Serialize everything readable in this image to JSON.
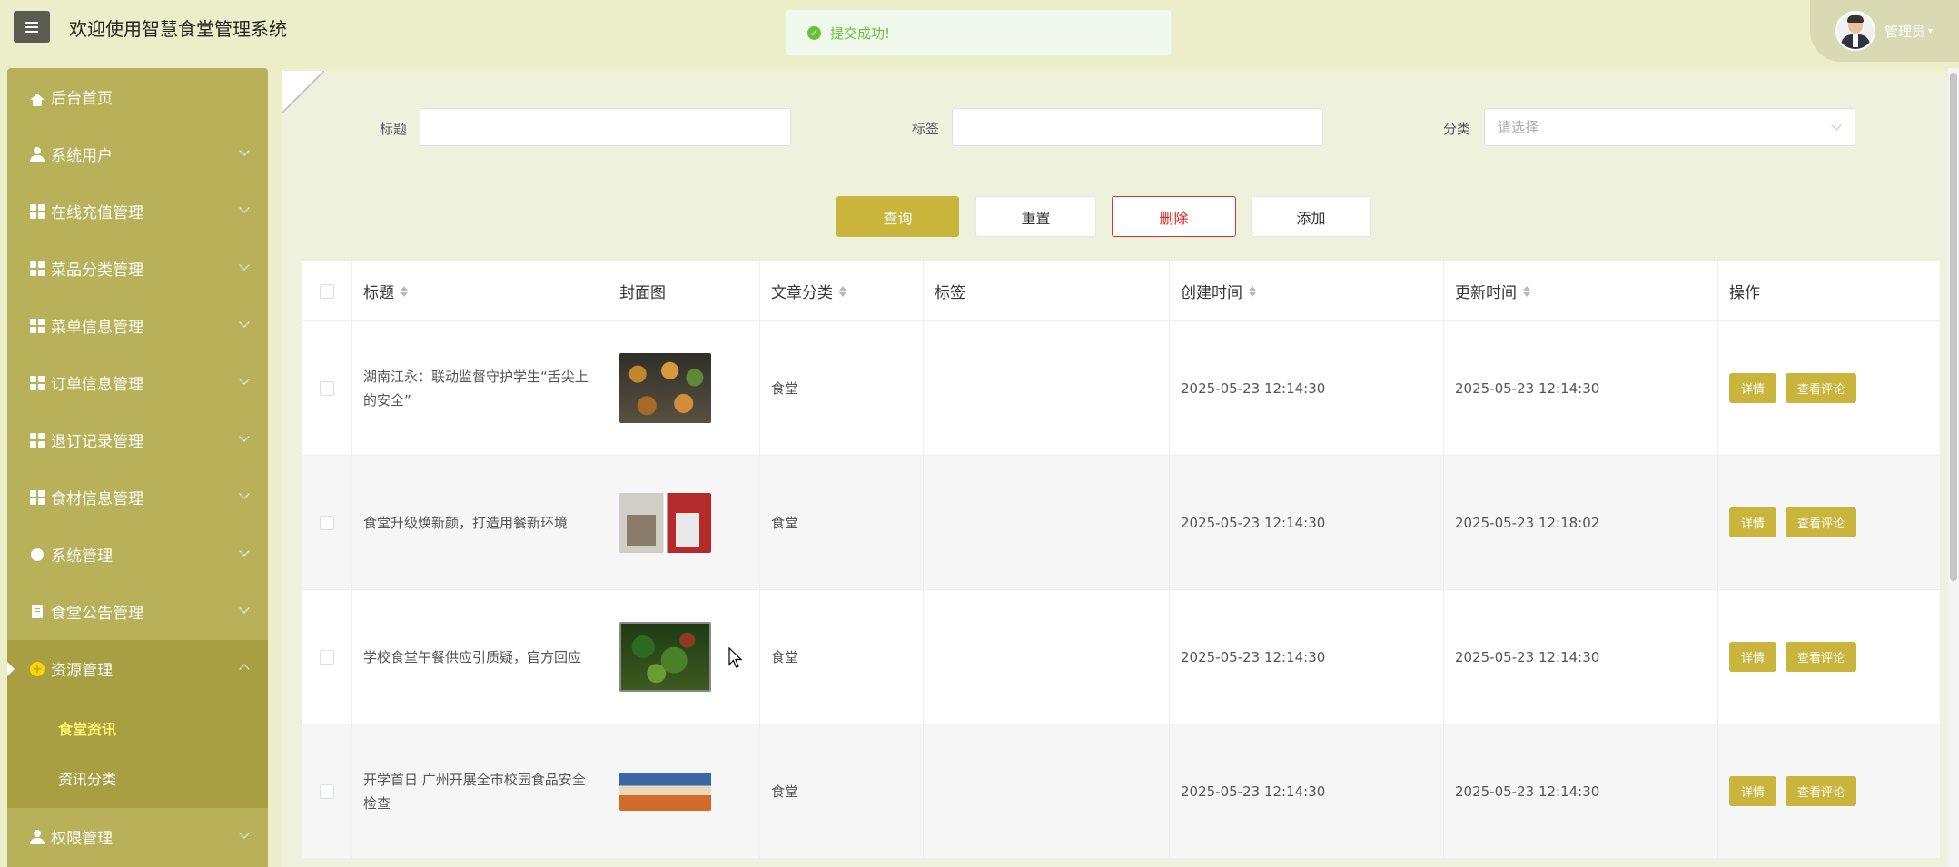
{
  "header": {
    "app_title": "欢迎使用智慧食堂管理系统",
    "toast_message": "提交成功!",
    "user_name": "管理员",
    "user_caret": "▾"
  },
  "sidebar": {
    "items": [
      {
        "label": "后台首页",
        "icon": "home-icon"
      },
      {
        "label": "系统用户",
        "icon": "user-icon"
      },
      {
        "label": "在线充值管理",
        "icon": "grid-icon"
      },
      {
        "label": "菜品分类管理",
        "icon": "grid-icon"
      },
      {
        "label": "菜单信息管理",
        "icon": "grid-icon"
      },
      {
        "label": "订单信息管理",
        "icon": "grid-icon"
      },
      {
        "label": "退订记录管理",
        "icon": "grid-icon"
      },
      {
        "label": "食材信息管理",
        "icon": "grid-icon"
      },
      {
        "label": "系统管理",
        "icon": "gear-icon"
      },
      {
        "label": "食堂公告管理",
        "icon": "document-icon"
      },
      {
        "label": "资源管理",
        "icon": "plus-circle-icon",
        "expanded": true
      },
      {
        "label": "权限管理",
        "icon": "user-icon"
      }
    ],
    "sub_items": [
      {
        "label": "食堂资讯",
        "active": true
      },
      {
        "label": "资讯分类",
        "active": false
      }
    ]
  },
  "filters": {
    "title_label": "标题",
    "title_value": "",
    "tag_label": "标签",
    "tag_value": "",
    "category_label": "分类",
    "category_placeholder": "请选择"
  },
  "actions": {
    "search": "查询",
    "reset": "重置",
    "delete": "删除",
    "add": "添加"
  },
  "table": {
    "columns": {
      "title": "标题",
      "cover": "封面图",
      "category": "文章分类",
      "tags": "标签",
      "created": "创建时间",
      "updated": "更新时间",
      "ops": "操作"
    },
    "rows": [
      {
        "title": "湖南江永：联动监督守护学生“舌尖上的安全”",
        "category": "食堂",
        "tags": "",
        "created": "2025-05-23 12:14:30",
        "updated": "2025-05-23 12:14:30"
      },
      {
        "title": "食堂升级焕新颜，打造用餐新环境",
        "category": "食堂",
        "tags": "",
        "created": "2025-05-23 12:14:30",
        "updated": "2025-05-23 12:18:02"
      },
      {
        "title": "学校食堂午餐供应引质疑，官方回应",
        "category": "食堂",
        "tags": "",
        "created": "2025-05-23 12:14:30",
        "updated": "2025-05-23 12:14:30"
      },
      {
        "title": "开学首日 广州开展全市校园食品安全检查",
        "category": "食堂",
        "tags": "",
        "created": "2025-05-23 12:14:30",
        "updated": "2025-05-23 12:14:30"
      }
    ],
    "op_detail": "详情",
    "op_comments": "查看评论"
  },
  "colors": {
    "accent": "#c9b53b",
    "sidebar": "#b9b15a",
    "success": "#67c23a",
    "danger": "#e02020"
  }
}
